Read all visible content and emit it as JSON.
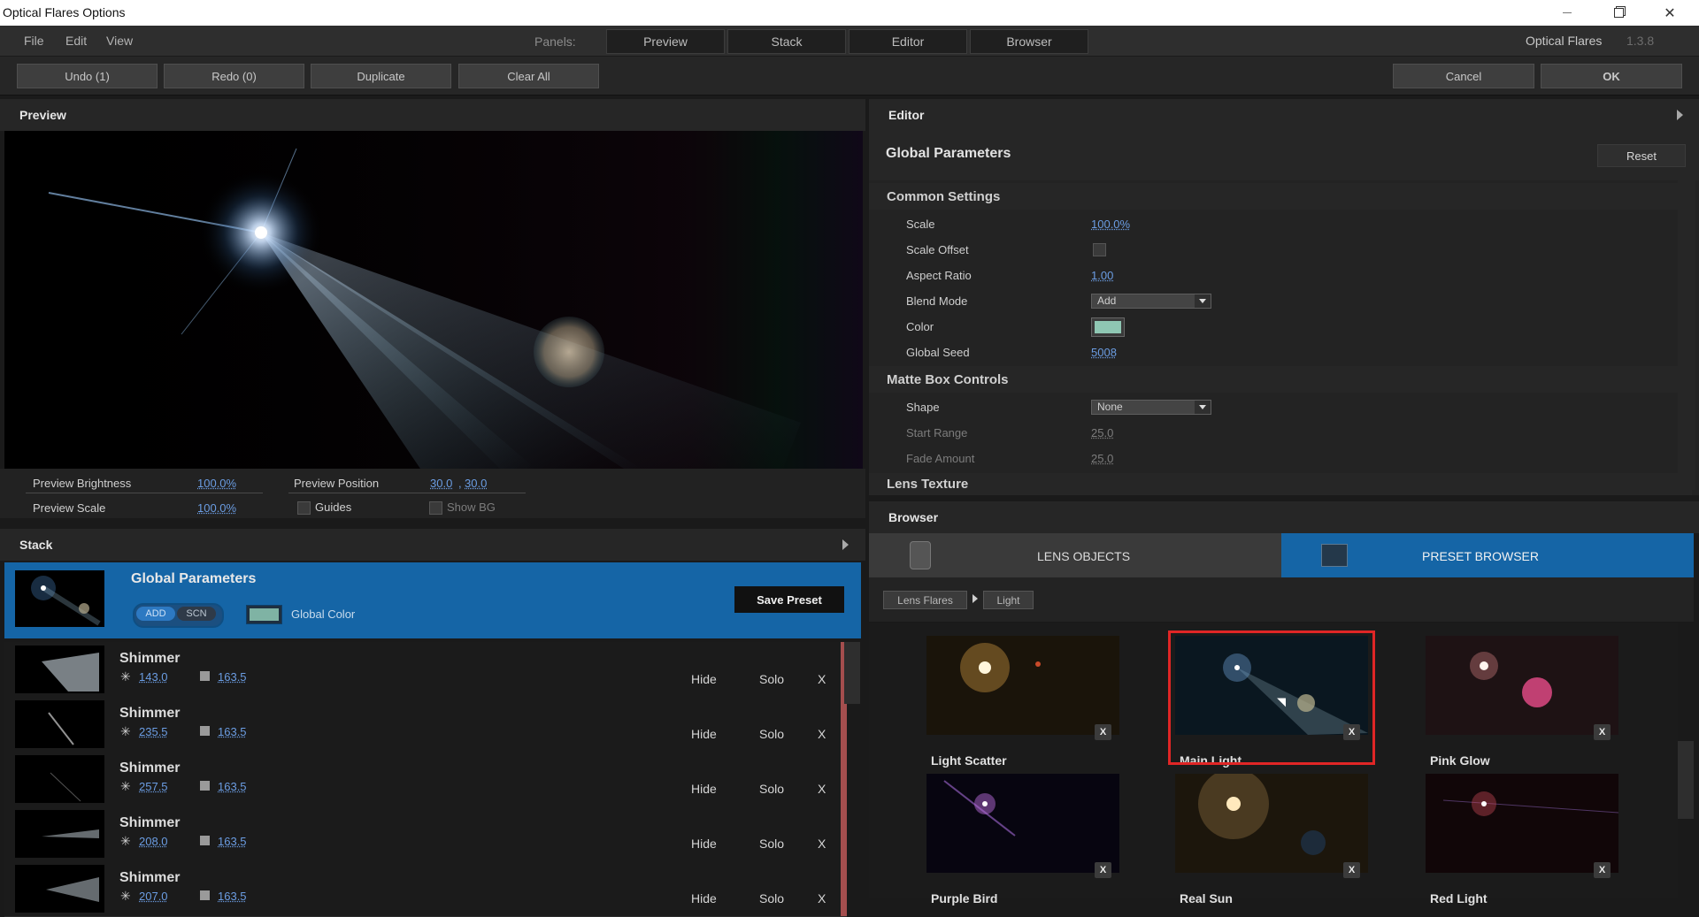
{
  "window": {
    "title": "Optical Flares Options"
  },
  "menu": {
    "file": "File",
    "edit": "Edit",
    "view": "View"
  },
  "panels": {
    "label": "Panels:",
    "tabs": [
      "Preview",
      "Stack",
      "Editor",
      "Browser"
    ]
  },
  "brand": {
    "name": "Optical Flares",
    "version": "1.3.8"
  },
  "toolbar": {
    "undo": "Undo (1)",
    "redo": "Redo (0)",
    "duplicate": "Duplicate",
    "clear_all": "Clear All",
    "cancel": "Cancel",
    "ok": "OK"
  },
  "preview": {
    "title": "Preview",
    "brightness_label": "Preview Brightness",
    "brightness_value": "100.0%",
    "scale_label": "Preview Scale",
    "scale_value": "100.0%",
    "position_label": "Preview Position",
    "position_x": "30.0",
    "position_sep": ",",
    "position_y": "30.0",
    "guides_label": "Guides",
    "show_bg_label": "Show BG"
  },
  "stack": {
    "title": "Stack",
    "global": {
      "title": "Global Parameters",
      "add": "ADD",
      "scn": "SCN",
      "color_label": "Global Color",
      "save_preset": "Save Preset",
      "color": "#7fb3a4"
    },
    "rows": [
      {
        "title": "Shimmer",
        "brightness": "143.0",
        "scale": "163.5",
        "hide": "Hide",
        "solo": "Solo",
        "x": "X"
      },
      {
        "title": "Shimmer",
        "brightness": "235.5",
        "scale": "163.5",
        "hide": "Hide",
        "solo": "Solo",
        "x": "X"
      },
      {
        "title": "Shimmer",
        "brightness": "257.5",
        "scale": "163.5",
        "hide": "Hide",
        "solo": "Solo",
        "x": "X"
      },
      {
        "title": "Shimmer",
        "brightness": "208.0",
        "scale": "163.5",
        "hide": "Hide",
        "solo": "Solo",
        "x": "X"
      },
      {
        "title": "Shimmer",
        "brightness": "207.0",
        "scale": "163.5",
        "hide": "Hide",
        "solo": "Solo",
        "x": "X"
      }
    ]
  },
  "editor": {
    "title": "Editor",
    "section_title": "Global Parameters",
    "reset": "Reset",
    "common_settings": "Common Settings",
    "scale_label": "Scale",
    "scale_value": "100.0%",
    "scale_offset_label": "Scale Offset",
    "aspect_label": "Aspect Ratio",
    "aspect_value": "1.00",
    "blend_label": "Blend Mode",
    "blend_value": "Add",
    "color_label": "Color",
    "color_value": "#8fc7b3",
    "seed_label": "Global Seed",
    "seed_value": "5008",
    "matte_box": "Matte Box Controls",
    "shape_label": "Shape",
    "shape_value": "None",
    "start_range_label": "Start Range",
    "start_range_value": "25.0",
    "fade_label": "Fade Amount",
    "fade_value": "25.0",
    "lens_texture": "Lens Texture"
  },
  "browser": {
    "title": "Browser",
    "tab_lens_objects": "LENS OBJECTS",
    "tab_preset_browser": "PRESET BROWSER",
    "crumb_root": "Lens Flares",
    "crumb_current": "Light",
    "presets": [
      {
        "name": "Light Scatter",
        "x": "X"
      },
      {
        "name": "Main Light",
        "x": "X"
      },
      {
        "name": "Pink Glow",
        "x": "X"
      },
      {
        "name": "Purple Bird",
        "x": "X"
      },
      {
        "name": "Real Sun",
        "x": "X"
      },
      {
        "name": "Red Light",
        "x": "X"
      }
    ],
    "selected_highlight": "#e02626",
    "active_tab_color": "#1565a6"
  }
}
